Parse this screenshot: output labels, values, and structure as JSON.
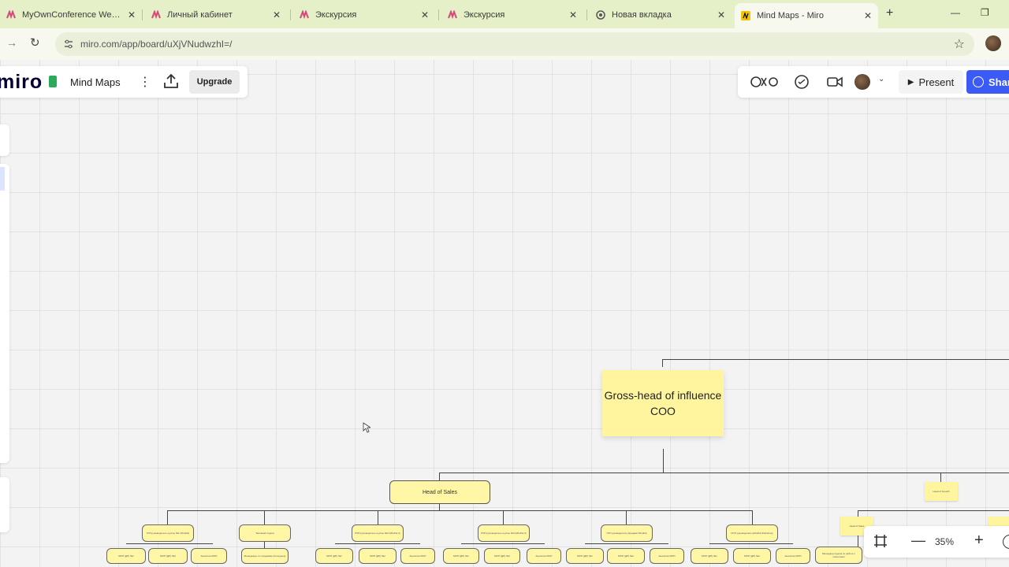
{
  "browser": {
    "tabs": [
      {
        "title": "MyOwnConference Webin",
        "favicon_color": "#d9467a"
      },
      {
        "title": "Личный кабинет",
        "favicon_color": "#d9467a"
      },
      {
        "title": "Экскурсия",
        "favicon_color": "#d9467a"
      },
      {
        "title": "Экскурсия",
        "favicon_color": "#d9467a"
      },
      {
        "title": "Новая вкладка",
        "favicon_color": "#555555"
      },
      {
        "title": "Mind Maps - Miro",
        "favicon_color": "#f2c500",
        "active": true
      }
    ],
    "url": "miro.com/app/board/uXjVNudwzhI=/"
  },
  "board": {
    "logo": "miro",
    "name": "Mind Maps",
    "upgrade_label": "Upgrade",
    "present_label": "Present",
    "share_label": "Share"
  },
  "zoom": {
    "value": "35%"
  },
  "mindmap": {
    "root": "Gross-head of influence COO",
    "head_of_sales": "Head of Sales",
    "level2": [
      "ГОП руководитель группы №1 (Mindful)",
      "Teamlead отдела",
      "РОП руководитель группы №2 (Mindful 2)",
      "РОП руководитель группы №3 (Mindful 3)",
      "ГОП руководитель (продажи Mindful)",
      "РОП руководитель (Mindful Workshop)"
    ],
    "level3": [
      "МОП (ДП) №1",
      "МОП (ДП) №2",
      "Аналитик МОП",
      "Менеджеры по продажам (Холодные)",
      "МОП (ДП) №1",
      "МОП (ДП) №2",
      "Аналитик МОП",
      "МОП (ДП) №1",
      "МОП (ДП) №2",
      "Аналитик МОП",
      "МОП (ДП) №1",
      "МОП (ДП) №2",
      "Аналитик МОП",
      "МОП (ДП) №1",
      "МОП (ДП) №2",
      "Аналитик МОП"
    ],
    "right_branch": "Head of Growth",
    "right_sub": "Head of Sales",
    "right_bottom": "Менеджер отдела по работе с клиентами"
  }
}
